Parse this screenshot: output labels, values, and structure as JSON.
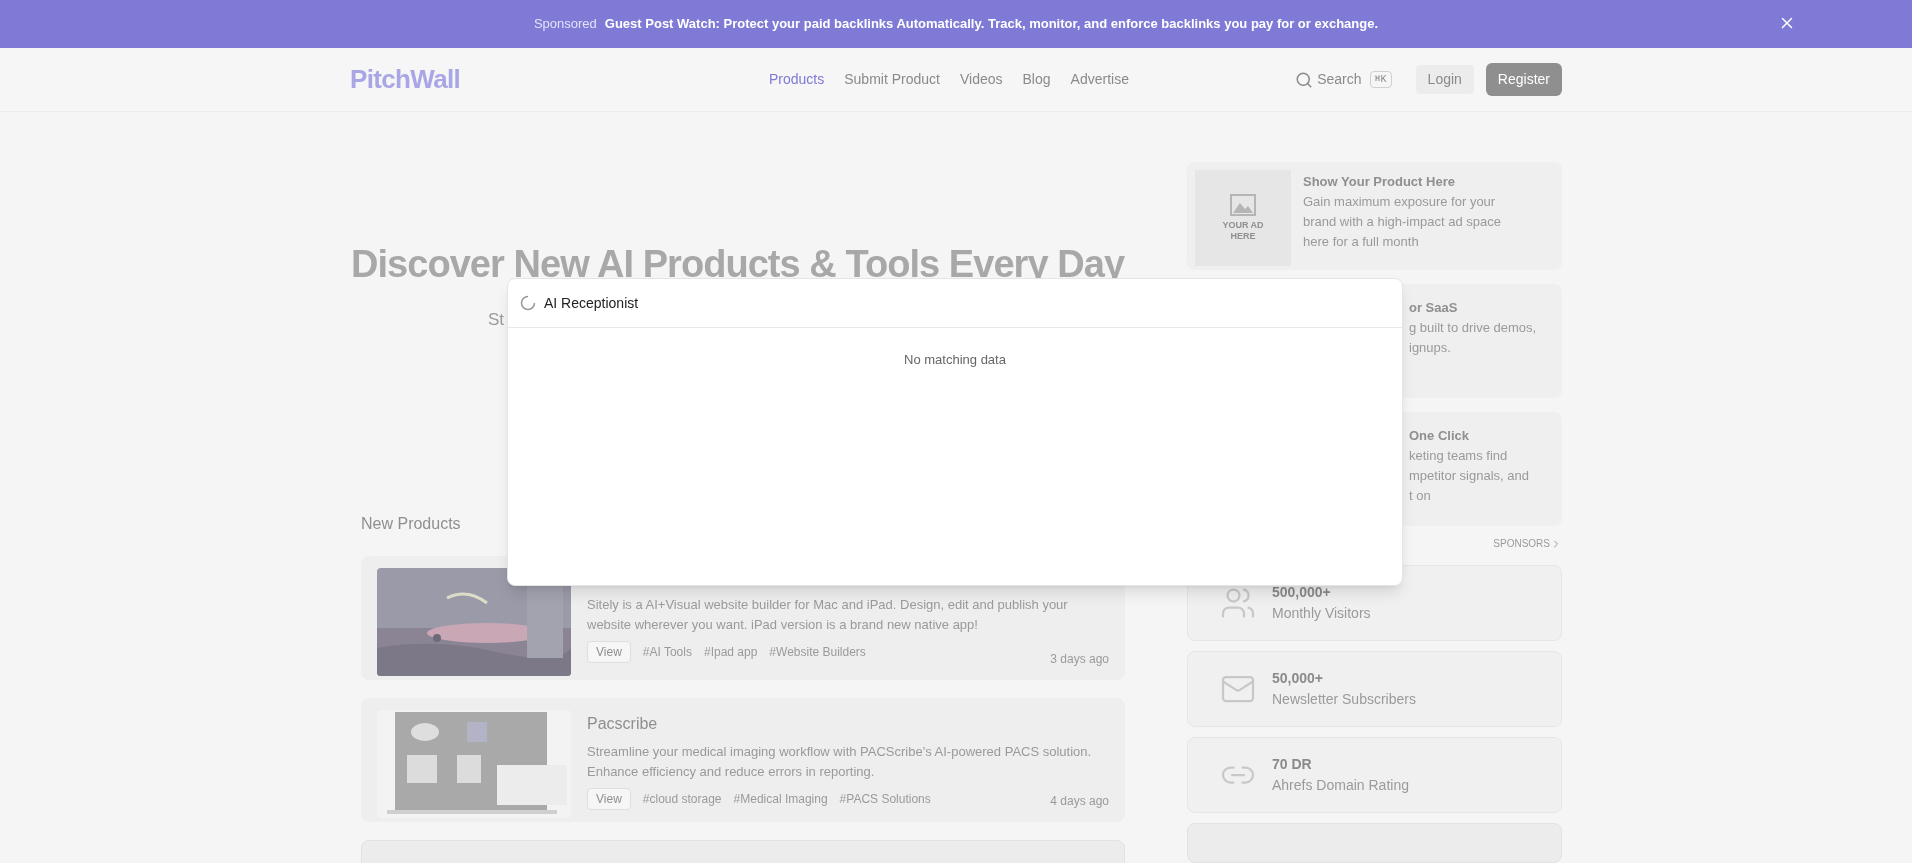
{
  "banner": {
    "sponsored": "Sponsored",
    "headline": "Guest Post Watch:",
    "text": "Protect your paid backlinks Automatically. Track, monitor, and enforce backlinks you pay for or exchange."
  },
  "nav": {
    "logo": "PitchWall",
    "links": [
      {
        "label": "Products",
        "selected": true
      },
      {
        "label": "Submit Product",
        "selected": false
      },
      {
        "label": "Videos",
        "selected": false
      },
      {
        "label": "Blog",
        "selected": false
      },
      {
        "label": "Advertise",
        "selected": false
      }
    ],
    "search": {
      "label": "Search",
      "shortcut": "⌘K"
    },
    "login": "Login",
    "register": "Register"
  },
  "hero": {
    "title": "Discover New AI Products & Tools Every Day",
    "subtitle": "St"
  },
  "new_products": {
    "heading": "New Products",
    "items": [
      {
        "description": "Sitely is a AI+Visual website builder for Mac and iPad. Design, edit and publish your website wherever you want. iPad version is a brand new native app!",
        "view": "View",
        "tags": [
          "#AI Tools",
          "#Ipad app",
          "#Website Builders"
        ],
        "time": "3 days ago"
      },
      {
        "title": "Pacscribe",
        "description": "Streamline your medical imaging workflow with PACScribe's AI-powered PACS solution. Enhance efficiency and reduce errors in reporting.",
        "view": "View",
        "tags": [
          "#cloud storage",
          "#Medical Imaging",
          "#PACS Solutions"
        ],
        "time": "4 days ago"
      }
    ]
  },
  "sponsors": {
    "ads": [
      {
        "kind": "full",
        "image_text": "YOUR AD HERE",
        "title": "Show Your Product Here",
        "lines": [
          "Gain maximum exposure for your",
          "brand with a high-impact ad space",
          "here for a full month"
        ]
      },
      {
        "kind": "covered",
        "title": "or SaaS",
        "lines": [
          "g built to drive demos,",
          "ignups."
        ]
      },
      {
        "kind": "covered",
        "title": "One Click",
        "lines": [
          "keting teams find",
          "mpetitor signals, and",
          "t on"
        ]
      }
    ],
    "link": "SPONSORS"
  },
  "stats": [
    {
      "value": "500,000+",
      "label": "Monthly Visitors"
    },
    {
      "value": "50,000+",
      "label": "Newsletter Subscribers"
    },
    {
      "value": "70 DR",
      "label": "Ahrefs Domain Rating"
    }
  ],
  "search_dialog": {
    "value": "AI Receptionist",
    "loading": true,
    "empty_text": "No matching data"
  }
}
